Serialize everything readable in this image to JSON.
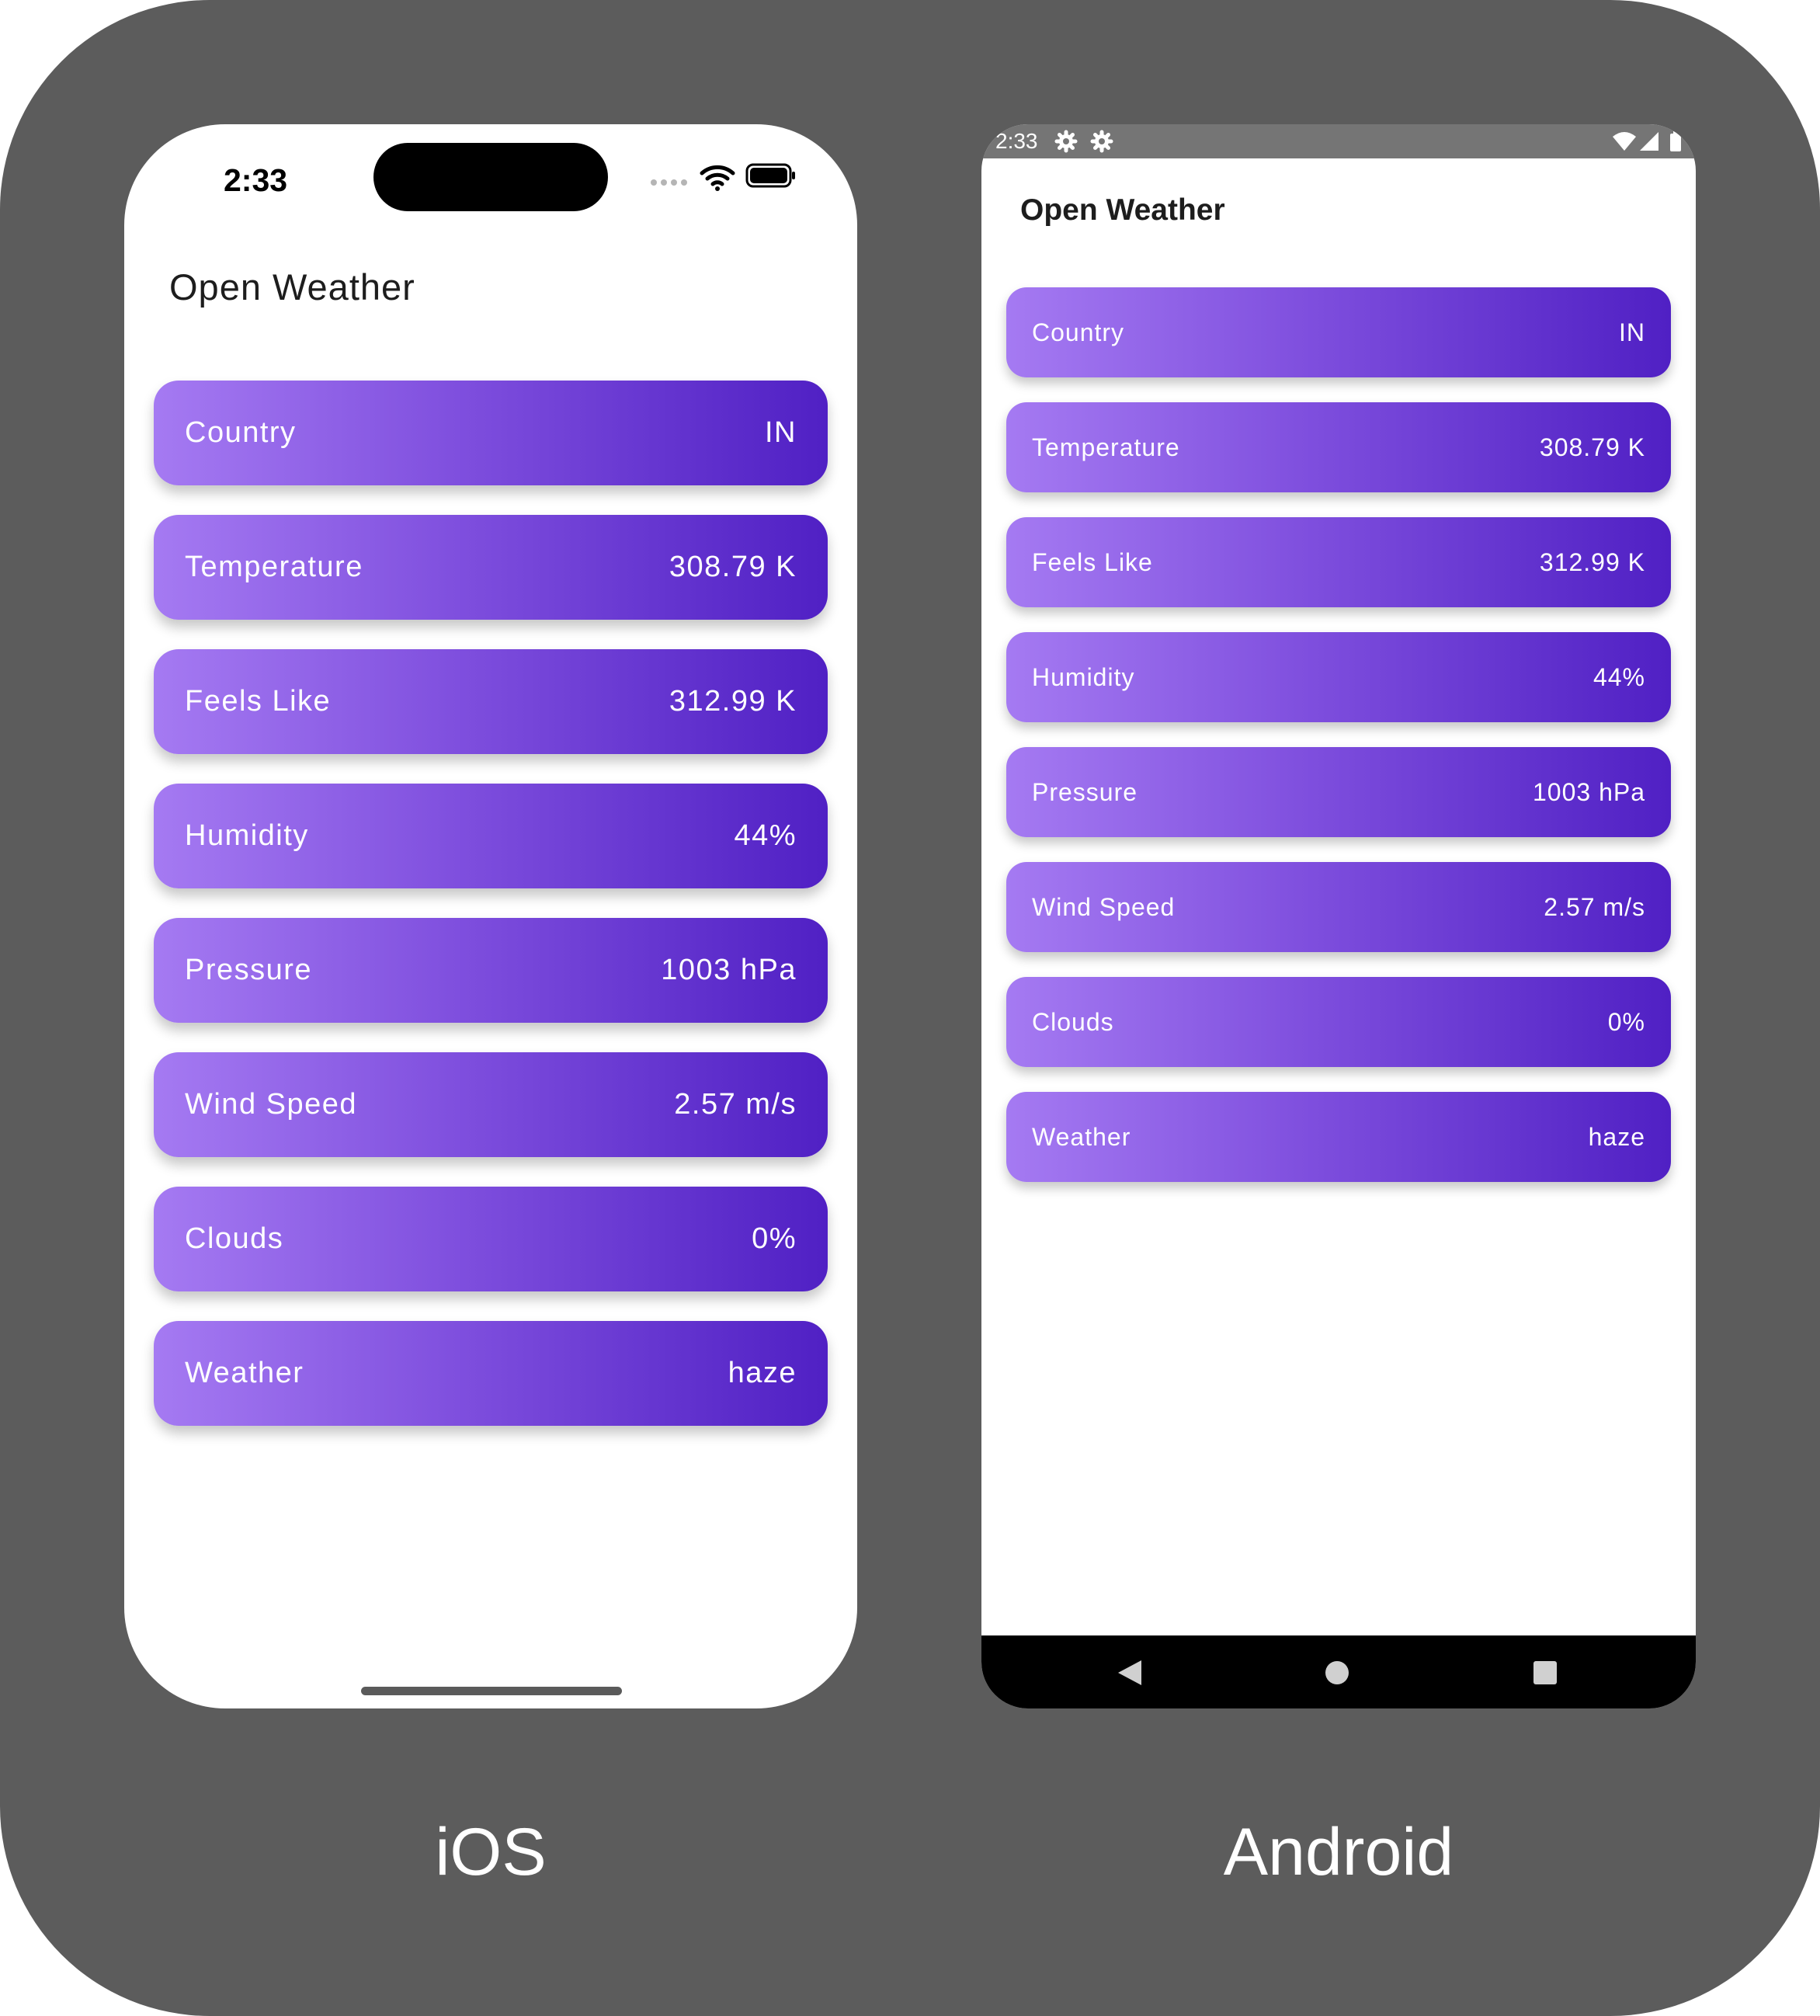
{
  "colors": {
    "frame": "#5c5c5c",
    "card_gradient_start": "#a57af2",
    "card_gradient_end": "#5020c4",
    "android_status_bar": "#757575"
  },
  "ios": {
    "status": {
      "time": "2:33",
      "icons": [
        "signal-dots-icon",
        "wifi-icon",
        "battery-icon"
      ]
    },
    "title": "Open Weather",
    "rows": [
      {
        "label": "Country",
        "value": "IN"
      },
      {
        "label": "Temperature",
        "value": "308.79 K"
      },
      {
        "label": "Feels Like",
        "value": "312.99 K"
      },
      {
        "label": "Humidity",
        "value": "44%"
      },
      {
        "label": "Pressure",
        "value": "1003 hPa"
      },
      {
        "label": "Wind Speed",
        "value": "2.57 m/s"
      },
      {
        "label": "Clouds",
        "value": "0%"
      },
      {
        "label": "Weather",
        "value": "haze"
      }
    ]
  },
  "android": {
    "status": {
      "time": "2:33",
      "icons": [
        "gear-icon",
        "gear-icon",
        "wifi-icon",
        "cell-signal-icon",
        "battery-icon"
      ]
    },
    "title": "Open Weather",
    "rows": [
      {
        "label": "Country",
        "value": "IN"
      },
      {
        "label": "Temperature",
        "value": "308.79 K"
      },
      {
        "label": "Feels Like",
        "value": "312.99 K"
      },
      {
        "label": "Humidity",
        "value": "44%"
      },
      {
        "label": "Pressure",
        "value": "1003 hPa"
      },
      {
        "label": "Wind Speed",
        "value": "2.57 m/s"
      },
      {
        "label": "Clouds",
        "value": "0%"
      },
      {
        "label": "Weather",
        "value": "haze"
      }
    ],
    "nav_icons": [
      "back-icon",
      "home-icon",
      "recents-icon"
    ]
  },
  "captions": {
    "ios": "iOS",
    "android": "Android"
  }
}
